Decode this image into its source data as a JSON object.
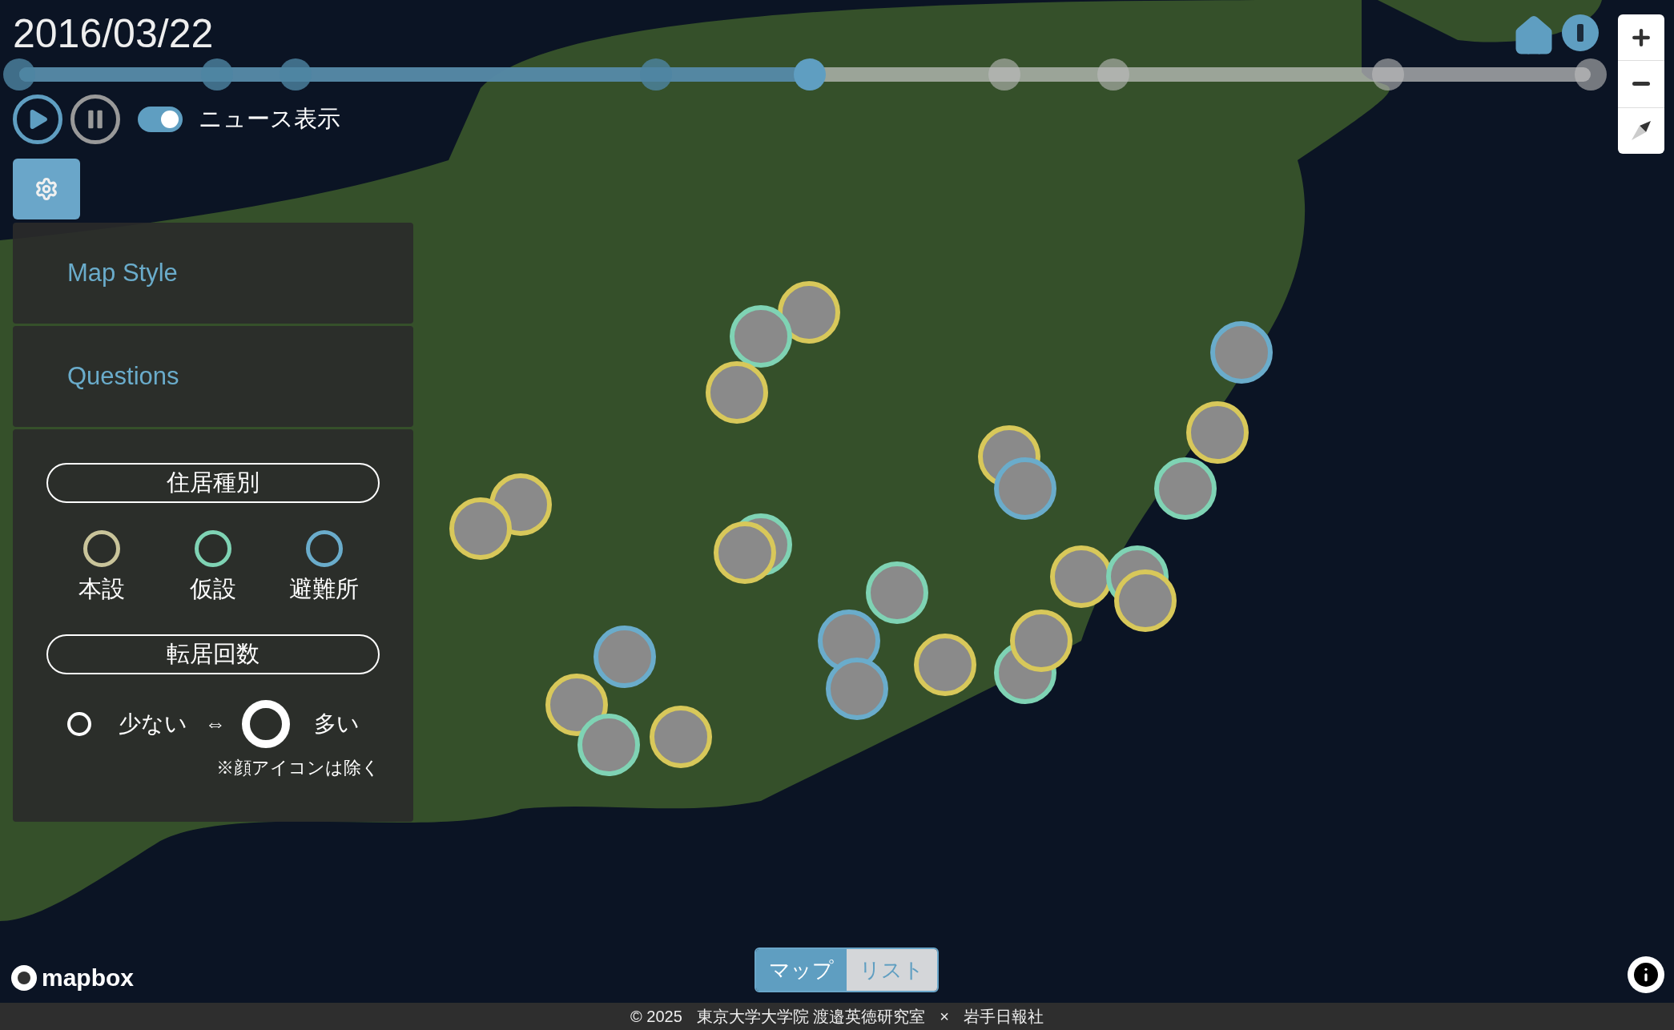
{
  "date": "2016/03/22",
  "timeline": {
    "level": 0.503
  },
  "controls": {
    "playing": false
  },
  "news_toggle": {
    "label": "ニュース表示",
    "on": true
  },
  "panel": {
    "sections": [
      {
        "title": "Map Style",
        "expanded": false
      },
      {
        "title": "Questions",
        "expanded": false
      }
    ],
    "housing_title": "住居種別",
    "housing_types": [
      {
        "label": "本設",
        "color": "#c9c49a"
      },
      {
        "label": "仮設",
        "color": "#7fd3b4"
      },
      {
        "label": "避難所",
        "color": "#6aaccb"
      }
    ],
    "moves_title": "転居回数",
    "moves_scale": {
      "low": "少ない",
      "arrow": "⇔",
      "high": "多い"
    },
    "note": "※顔アイコンは除く"
  },
  "view_tabs": [
    {
      "label": "マップ",
      "selected": true
    },
    {
      "label": "リスト",
      "selected": false
    }
  ],
  "map_logo": "mapbox",
  "footer": {
    "copyright": "© 2025",
    "lab": "東京大学大学院 渡邉英徳研究室",
    "separator": "×",
    "partner": "岩手日報社"
  }
}
